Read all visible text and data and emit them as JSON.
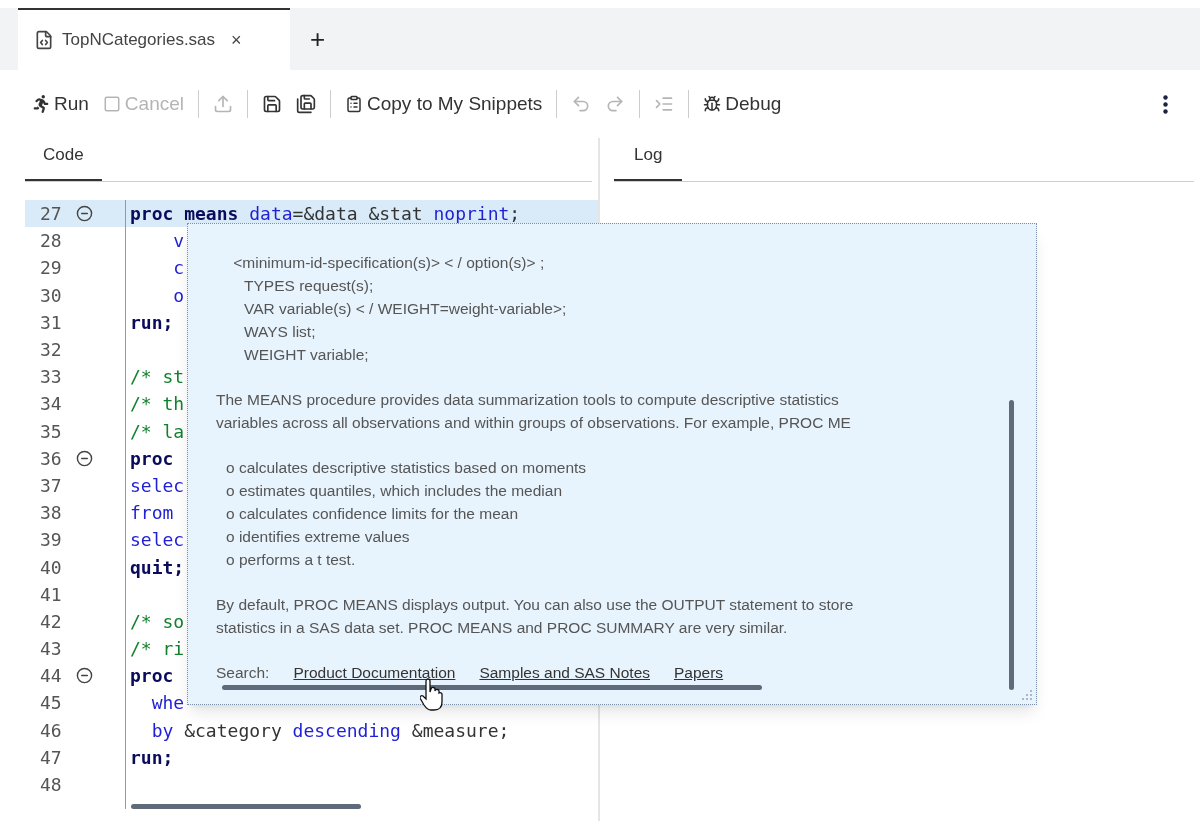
{
  "tabs": [
    {
      "label": "TopNCategories.sas",
      "selected": true,
      "close": "×"
    }
  ],
  "new_tab": "+",
  "toolbar": [
    {
      "kind": "button",
      "label": "Run",
      "disabled": false
    },
    {
      "kind": "button",
      "label": "Cancel",
      "disabled": true
    },
    {
      "kind": "separator"
    },
    {
      "kind": "icon",
      "disabled": true
    },
    {
      "kind": "separator"
    },
    {
      "kind": "icon",
      "disabled": false
    },
    {
      "kind": "icon",
      "disabled": false
    },
    {
      "kind": "separator"
    },
    {
      "kind": "button",
      "label": "Copy to My Snippets",
      "disabled": false
    },
    {
      "kind": "separator"
    },
    {
      "kind": "icon",
      "disabled": true
    },
    {
      "kind": "icon",
      "disabled": true
    },
    {
      "kind": "separator"
    },
    {
      "kind": "icon",
      "disabled": true
    },
    {
      "kind": "separator"
    },
    {
      "kind": "button",
      "label": "Debug",
      "disabled": false
    }
  ],
  "code_pane": {
    "tab": {
      "label": "Code",
      "selected": true
    },
    "lines": [
      {
        "number": "27",
        "foldable": true,
        "selected": true,
        "tokens": [
          {
            "kind": "keyword",
            "text": "proc"
          },
          {
            "kind": "keyword",
            "text": " means"
          },
          {
            "kind": "builtin",
            "text": " data"
          },
          {
            "kind": "plain",
            "text": "=&data &stat "
          },
          {
            "kind": "builtin",
            "text": "noprint"
          },
          {
            "kind": "plain",
            "text": ";"
          }
        ]
      },
      {
        "number": "28",
        "foldable": false,
        "selected": false,
        "tokens": [
          {
            "kind": "builtin",
            "text": "    v"
          }
        ]
      },
      {
        "number": "29",
        "foldable": false,
        "selected": false,
        "tokens": [
          {
            "kind": "builtin",
            "text": "    c"
          }
        ]
      },
      {
        "number": "30",
        "foldable": false,
        "selected": false,
        "tokens": [
          {
            "kind": "builtin",
            "text": "    o"
          }
        ]
      },
      {
        "number": "31",
        "foldable": false,
        "selected": false,
        "tokens": [
          {
            "kind": "keyword",
            "text": "run;"
          }
        ]
      },
      {
        "number": "32",
        "foldable": false,
        "selected": false
      },
      {
        "number": "33",
        "foldable": false,
        "selected": false,
        "tokens": [
          {
            "kind": "comment",
            "text": "/* st"
          }
        ]
      },
      {
        "number": "34",
        "foldable": false,
        "selected": false,
        "tokens": [
          {
            "kind": "comment",
            "text": "/* th"
          }
        ]
      },
      {
        "number": "35",
        "foldable": false,
        "selected": false,
        "tokens": [
          {
            "kind": "comment",
            "text": "/* la"
          }
        ]
      },
      {
        "number": "36",
        "foldable": true,
        "selected": false,
        "tokens": [
          {
            "kind": "keyword",
            "text": "proc"
          }
        ]
      },
      {
        "number": "37",
        "foldable": false,
        "selected": false,
        "tokens": [
          {
            "kind": "builtin",
            "text": "selec"
          }
        ]
      },
      {
        "number": "38",
        "foldable": false,
        "selected": false,
        "tokens": [
          {
            "kind": "builtin",
            "text": "from"
          }
        ]
      },
      {
        "number": "39",
        "foldable": false,
        "selected": false,
        "tokens": [
          {
            "kind": "builtin",
            "text": "selec"
          }
        ]
      },
      {
        "number": "40",
        "foldable": false,
        "selected": false,
        "tokens": [
          {
            "kind": "keyword",
            "text": "quit;"
          }
        ]
      },
      {
        "number": "41",
        "foldable": false,
        "selected": false
      },
      {
        "number": "42",
        "foldable": false,
        "selected": false,
        "tokens": [
          {
            "kind": "comment",
            "text": "/* so"
          }
        ]
      },
      {
        "number": "43",
        "foldable": false,
        "selected": false,
        "tokens": [
          {
            "kind": "comment",
            "text": "/* ri"
          }
        ]
      },
      {
        "number": "44",
        "foldable": true,
        "selected": false,
        "tokens": [
          {
            "kind": "keyword",
            "text": "proc"
          }
        ]
      },
      {
        "number": "45",
        "foldable": false,
        "selected": false,
        "tokens": [
          {
            "kind": "builtin",
            "text": "  whe"
          }
        ]
      },
      {
        "number": "46",
        "foldable": false,
        "selected": false,
        "tokens": [
          {
            "kind": "builtin",
            "text": "  by"
          },
          {
            "kind": "plain",
            "text": " &category "
          },
          {
            "kind": "builtin",
            "text": "descending"
          },
          {
            "kind": "plain",
            "text": " &measure;"
          }
        ]
      },
      {
        "number": "47",
        "foldable": false,
        "selected": false,
        "tokens": [
          {
            "kind": "keyword",
            "text": "run;"
          }
        ]
      },
      {
        "number": "48",
        "foldable": false,
        "selected": false
      }
    ]
  },
  "log_pane": {
    "tab": {
      "label": "Log",
      "selected": true
    }
  },
  "help_popup": {
    "syntax": [
      "    <minimum-id-specification(s)> < / option(s)> ;",
      "TYPES request(s);",
      "VAR variable(s) < / WEIGHT=weight-variable>;",
      "WAYS list;",
      "WEIGHT variable;"
    ],
    "description": [
      "The MEANS procedure provides data summarization tools to compute descriptive statistics",
      "variables across all observations and within groups of observations. For example, PROC ME"
    ],
    "bullets": [
      "o calculates descriptive statistics based on moments",
      "o estimates quantiles, which includes the median",
      "o calculates confidence limits for the mean",
      "o identifies extreme values",
      "o performs a t test."
    ],
    "note": [
      "By default, PROC MEANS displays output. You can also use the OUTPUT statement to store",
      "statistics in a SAS data set. PROC MEANS and PROC SUMMARY are very similar."
    ],
    "search_label": "Search:",
    "links": [
      "Product Documentation",
      "Samples and SAS Notes",
      "Papers"
    ]
  }
}
